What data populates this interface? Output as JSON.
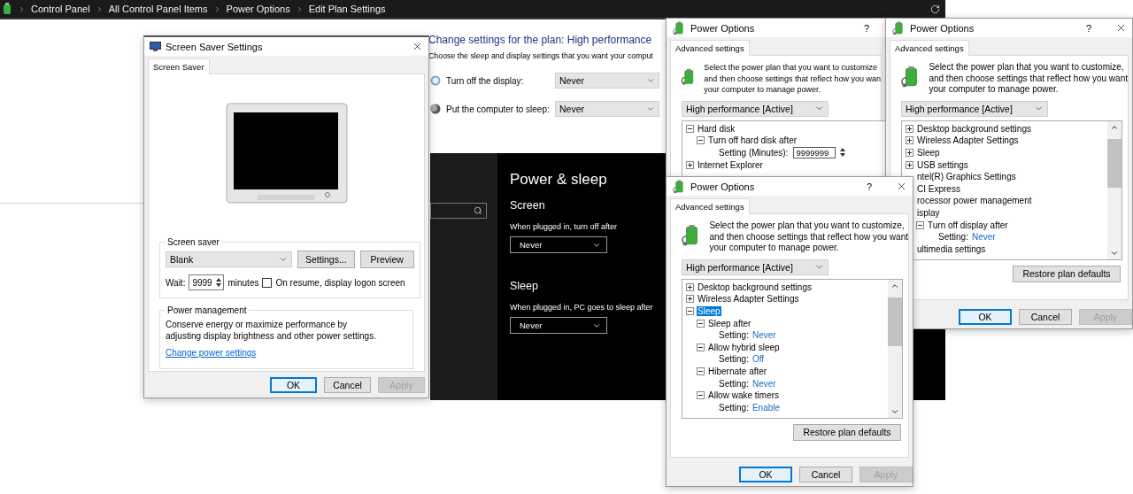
{
  "address_bar": {
    "breadcrumbs": [
      "Control Panel",
      "All Control Panel Items",
      "Power Options",
      "Edit Plan Settings"
    ]
  },
  "screen_saver_dialog": {
    "title": "Screen Saver Settings",
    "tabs": [
      {
        "label": "Screen Saver",
        "selected": true
      }
    ],
    "screen_saver": {
      "legend": "Screen saver",
      "selection": "Blank",
      "buttons": [
        "Settings...",
        "Preview"
      ],
      "wait_label": "Wait:",
      "wait_value": "9999",
      "wait_unit": "minutes",
      "logon_option": {
        "label": "On resume, display logon screen",
        "checked": false
      }
    },
    "power_management": {
      "legend": "Power management",
      "description": "Conserve energy or maximize performance by adjusting display brightness and other power settings.",
      "link": "Change power settings"
    },
    "buttons": [
      {
        "label": "OK",
        "kind": "default"
      },
      {
        "label": "Cancel",
        "kind": "normal"
      },
      {
        "label": "Apply",
        "kind": "disabled"
      }
    ]
  },
  "plan_settings": {
    "title": "Change settings for the plan: High performance",
    "subtitle": "Choose the sleep and display settings that you want your comput",
    "rows": [
      {
        "kind": "display",
        "label": "Turn off the display:",
        "value": "Never"
      },
      {
        "kind": "sleep",
        "label": "Put the computer to sleep:",
        "value": "Never"
      }
    ]
  },
  "settings_app": {
    "heading": "Power & sleep",
    "sections": [
      {
        "title": "Screen",
        "label": "When plugged in, turn off after",
        "value": "Never"
      },
      {
        "title": "Sleep",
        "label": "When plugged in, PC goes to sleep after",
        "value": "Never"
      }
    ]
  },
  "power_options_windows": [
    {
      "title": "Power Options",
      "help": "?",
      "close": false,
      "tabs": [
        {
          "label": "Advanced settings",
          "selected": true
        }
      ],
      "description": [
        "Select the power plan that you want to customize",
        "and then choose settings that reflect how you wan",
        "your computer to manage power."
      ],
      "plan": "High performance [Active]",
      "tree": [
        {
          "kind": "group",
          "label": "Hard disk",
          "expanded": true,
          "selected": false,
          "children": [
            {
              "kind": "group",
              "label": "Turn off hard disk after",
              "expanded": true,
              "selected": false,
              "children": [
                {
                  "kind": "spin",
                  "label": "Setting (Minutes):",
                  "value": "9999999",
                  "selected": false
                }
              ]
            }
          ]
        },
        {
          "kind": "group",
          "label": "Internet Explorer",
          "expanded": false,
          "selected": false
        }
      ]
    },
    {
      "title": "Power Options",
      "help": "?",
      "close": true,
      "tabs": [
        {
          "label": "Advanced settings",
          "selected": true
        }
      ],
      "description": [
        "Select the power plan that you want to customize,",
        "and then choose settings that reflect how you want",
        "your computer to manage power."
      ],
      "plan": "High performance [Active]",
      "tree": [
        {
          "kind": "group",
          "label": "Desktop background settings",
          "expanded": false,
          "selected": false
        },
        {
          "kind": "group",
          "label": "Wireless Adapter Settings",
          "expanded": false,
          "selected": false
        },
        {
          "kind": "group",
          "label": "Sleep",
          "expanded": false,
          "selected": false
        },
        {
          "kind": "group",
          "label": "USB settings",
          "expanded": false,
          "selected": false
        },
        {
          "kind": "clipped",
          "label": "ntel(R) Graphics Settings",
          "selected": false
        },
        {
          "kind": "clipped",
          "label": "CI Express",
          "selected": false
        },
        {
          "kind": "clipped",
          "label": "rocessor power management",
          "selected": false
        },
        {
          "kind": "clipped",
          "label": "isplay",
          "selected": false,
          "children": [
            {
              "kind": "group",
              "label": "Turn off display after",
              "expanded": true,
              "selected": false,
              "children": [
                {
                  "kind": "setting",
                  "label": "Setting:",
                  "value": "Never",
                  "selected": false
                }
              ]
            }
          ]
        },
        {
          "kind": "clipped",
          "label": "ultimedia settings",
          "selected": false
        }
      ],
      "restore": "Restore plan defaults",
      "buttons": [
        {
          "label": "OK",
          "kind": "default"
        },
        {
          "label": "Cancel",
          "kind": "normal"
        },
        {
          "label": "Apply",
          "kind": "disabled"
        }
      ]
    },
    {
      "title": "Power Options",
      "help": "?",
      "close": true,
      "tabs": [
        {
          "label": "Advanced settings",
          "selected": true
        }
      ],
      "description": [
        "Select the power plan that you want to customize,",
        "and then choose settings that reflect how you want",
        "your computer to manage power."
      ],
      "plan": "High performance [Active]",
      "tree": [
        {
          "kind": "group",
          "label": "Desktop background settings",
          "expanded": false,
          "selected": false
        },
        {
          "kind": "group",
          "label": "Wireless Adapter Settings",
          "expanded": false,
          "selected": false
        },
        {
          "kind": "group",
          "label": "Sleep",
          "expanded": true,
          "selected": true,
          "children": [
            {
              "kind": "group",
              "label": "Sleep after",
              "expanded": true,
              "selected": false,
              "children": [
                {
                  "kind": "setting",
                  "label": "Setting:",
                  "value": "Never",
                  "selected": false
                }
              ]
            },
            {
              "kind": "group",
              "label": "Allow hybrid sleep",
              "expanded": true,
              "selected": false,
              "children": [
                {
                  "kind": "setting",
                  "label": "Setting:",
                  "value": "Off",
                  "selected": false
                }
              ]
            },
            {
              "kind": "group",
              "label": "Hibernate after",
              "expanded": true,
              "selected": false,
              "children": [
                {
                  "kind": "setting",
                  "label": "Setting:",
                  "value": "Never",
                  "selected": false
                }
              ]
            },
            {
              "kind": "group",
              "label": "Allow wake timers",
              "expanded": true,
              "selected": false,
              "children": [
                {
                  "kind": "setting",
                  "label": "Setting:",
                  "value": "Enable",
                  "selected": false
                }
              ]
            }
          ]
        }
      ],
      "restore": "Restore plan defaults",
      "buttons": [
        {
          "label": "OK",
          "kind": "default"
        },
        {
          "label": "Cancel",
          "kind": "normal"
        },
        {
          "label": "Apply",
          "kind": "disabled"
        }
      ]
    }
  ]
}
